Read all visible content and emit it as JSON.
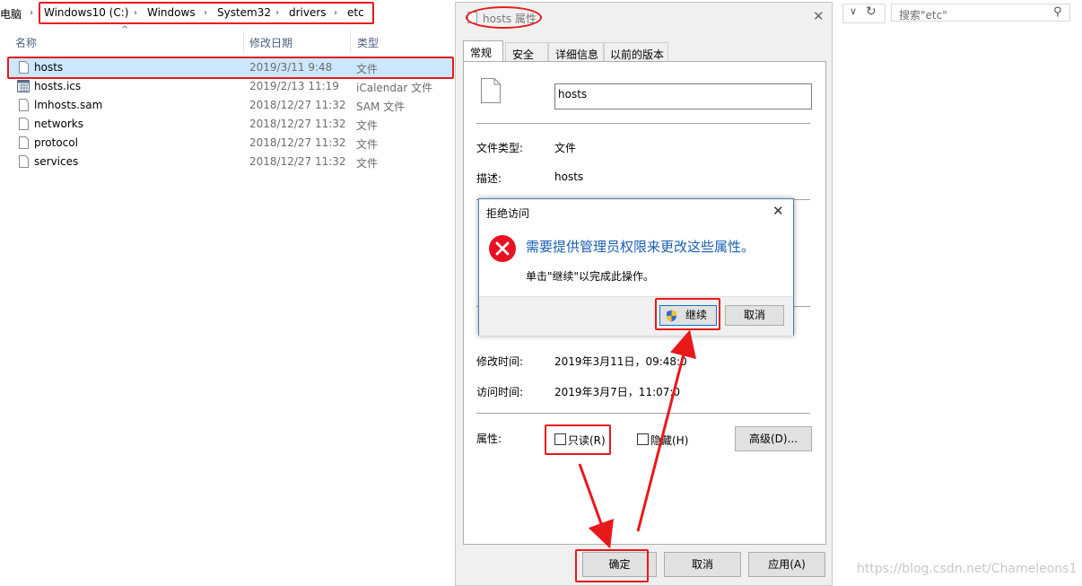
{
  "explorer": {
    "breadcrumb": [
      "电脑",
      "Windows10 (C:)",
      "Windows",
      "System32",
      "drivers",
      "etc"
    ],
    "search_placeholder": "搜索\"etc\"",
    "columns": {
      "name": "名称",
      "date": "修改日期",
      "type": "类型"
    },
    "files": [
      {
        "name": "hosts",
        "date": "2019/3/11 9:48",
        "type": "文件",
        "selected": true
      },
      {
        "name": "hosts.ics",
        "date": "2019/2/13 11:19",
        "type": "iCalendar 文件"
      },
      {
        "name": "lmhosts.sam",
        "date": "2018/12/27 11:32",
        "type": "SAM 文件"
      },
      {
        "name": "networks",
        "date": "2018/12/27 11:32",
        "type": "文件"
      },
      {
        "name": "protocol",
        "date": "2018/12/27 11:32",
        "type": "文件"
      },
      {
        "name": "services",
        "date": "2018/12/27 11:32",
        "type": "文件"
      }
    ]
  },
  "properties": {
    "title": "hosts 属性",
    "tabs": [
      "常规",
      "安全",
      "详细信息",
      "以前的版本"
    ],
    "filename": "hosts",
    "fields": {
      "file_type_label": "文件类型:",
      "file_type_value": "文件",
      "desc_label": "描述:",
      "desc_value": "hosts",
      "modified_label": "修改时间:",
      "modified_value": "2019年3月11日，09:48:0",
      "accessed_label": "访问时间:",
      "accessed_value": "2019年3月7日，11:07:0",
      "attributes_label": "属性:"
    },
    "readonly_label": "只读(R)",
    "hidden_label": "隐藏(H)",
    "advanced_label": "高级(D)...",
    "ok_label": "确定",
    "cancel_label": "取消",
    "apply_label": "应用(A)"
  },
  "denied": {
    "title": "拒绝访问",
    "message": "需要提供管理员权限来更改这些属性。",
    "sub": "单击\"继续\"以完成此操作。",
    "continue_label": "继续",
    "cancel_label": "取消"
  },
  "watermark": "https://blog.csdn.net/Chameleons1",
  "colors": {
    "highlight": "#e8191a",
    "accent": "#1a5fb4",
    "error": "#e81123"
  }
}
